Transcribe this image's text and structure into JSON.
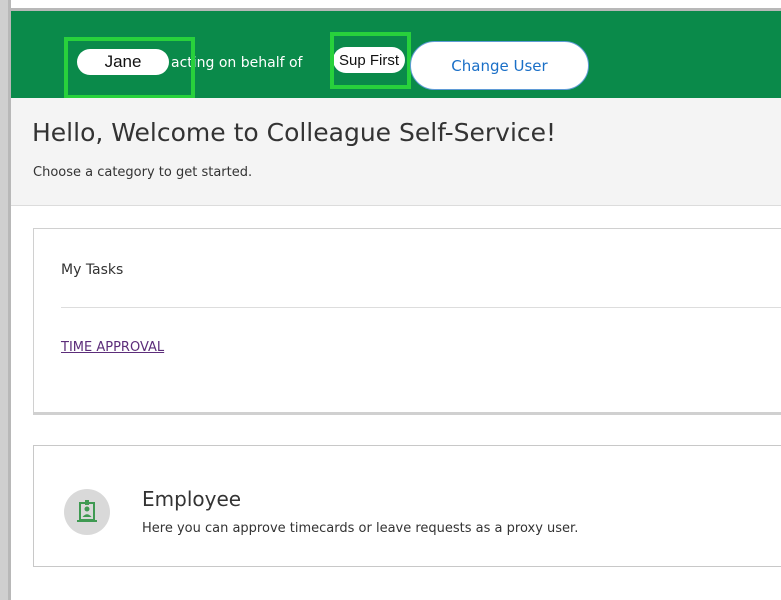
{
  "header": {
    "user_name": "Jane",
    "acting_text": "acting on behalf of",
    "proxy_name": "Sup First",
    "change_user_label": "Change User"
  },
  "welcome": {
    "title": "Hello, Welcome to Colleague Self-Service!",
    "subtitle": "Choose a category to get started."
  },
  "tasks": {
    "title": "My Tasks",
    "items": [
      {
        "label": "TIME APPROVAL"
      }
    ]
  },
  "categories": [
    {
      "title": "Employee",
      "description": "Here you can approve timecards or leave requests as a proxy user.",
      "icon": "employee-badge-icon"
    }
  ],
  "colors": {
    "header_bg": "#0a8a4a",
    "highlight": "#28d13c",
    "link": "#5c2d7a",
    "button_text": "#1a6fc7",
    "icon_green": "#3f9a52"
  }
}
